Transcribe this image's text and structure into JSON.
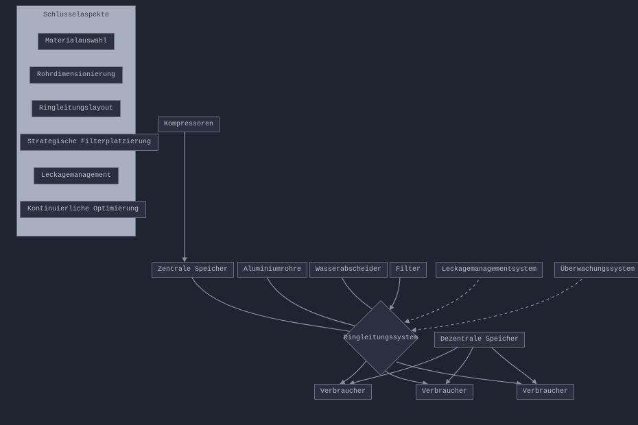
{
  "panel": {
    "title": "Schlüsselaspekte",
    "items": [
      "Materialauswahl",
      "Rohrdimensionierung",
      "Ringleitungslayout",
      "Strategische Filterplatzierung",
      "Leckagemanagement",
      "Kontinuierliche Optimierung"
    ]
  },
  "nodes": {
    "kompressoren": "Kompressoren",
    "zentrale_speicher": "Zentrale Speicher",
    "aluminiumrohre": "Aluminiumrohre",
    "wasserabscheider": "Wasserabscheider",
    "filter": "Filter",
    "leckagemanagementsystem": "Leckagemanagementsystem",
    "ueberwachungssystem": "Überwachungssystem",
    "ringleitungssystem": "Ringleitungssystem",
    "dezentrale_speicher": "Dezentrale Speicher",
    "verbraucher1": "Verbraucher",
    "verbraucher2": "Verbraucher",
    "verbraucher3": "Verbraucher"
  }
}
